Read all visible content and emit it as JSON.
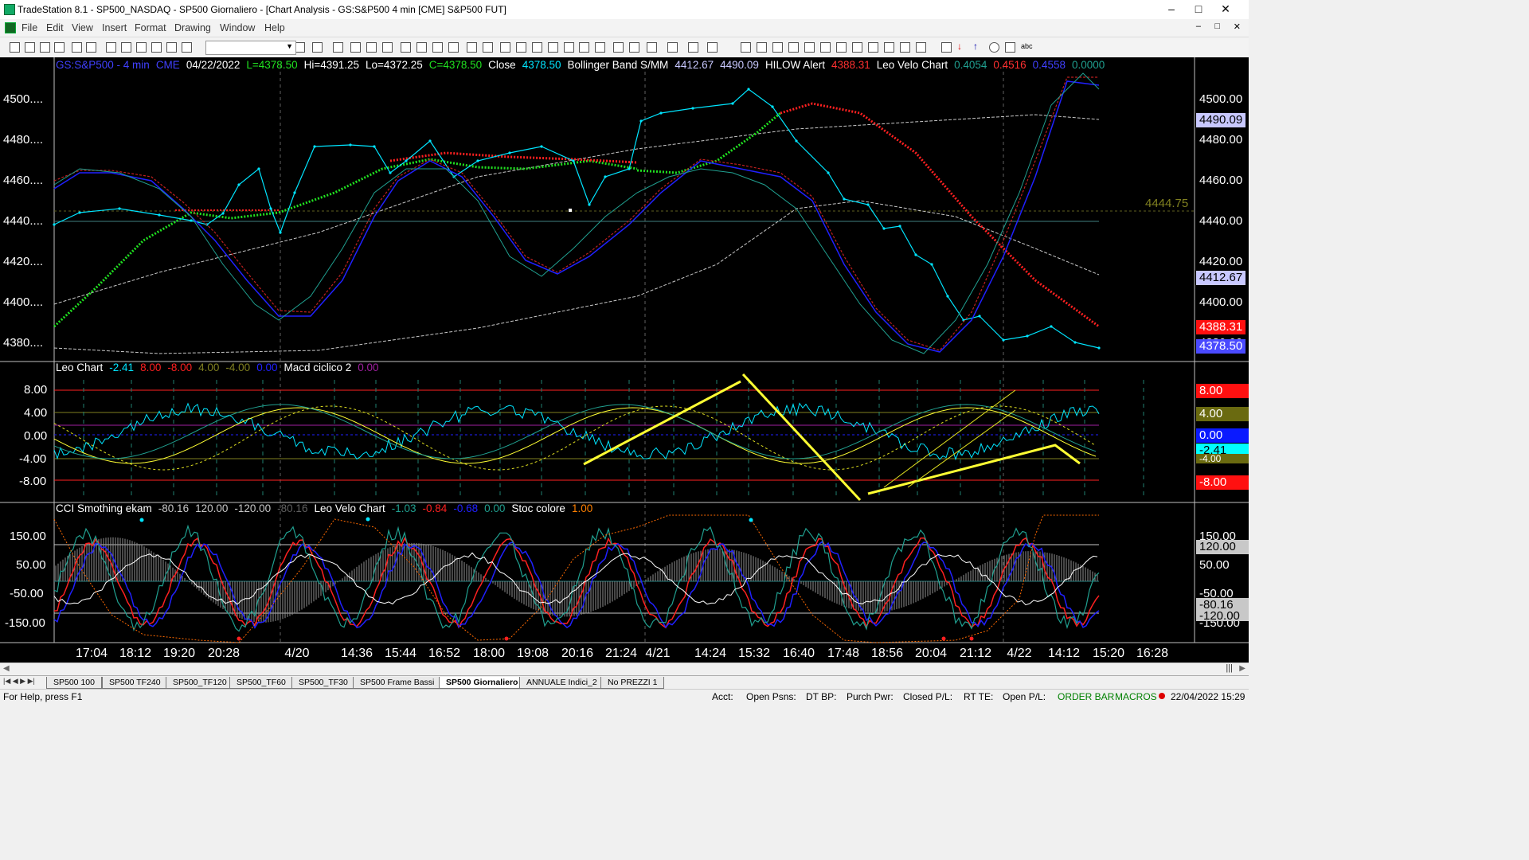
{
  "window": {
    "title": "TradeStation 8.1 - SP500_NASDAQ - SP500 Giornaliero - [Chart Analysis - GS:S&P500  4 min  [CME] S&P500 FUT]"
  },
  "menu": [
    "File",
    "Edit",
    "View",
    "Insert",
    "Format",
    "Drawing",
    "Window",
    "Help"
  ],
  "price_legend": {
    "symbol": "GS:S&P500 - 4 min",
    "exchange": "CME",
    "date": "04/22/2022",
    "low": "L=4378.50",
    "high": "Hi=4391.25",
    "lo": "Lo=4372.25",
    "close_field": "C=4378.50",
    "close_label": "Close",
    "close_value": "4378.50",
    "bb_label": "Bollinger Band S/MM",
    "bb_v1": "4412.67",
    "bb_v2": "4490.09",
    "hilow_label": "HILOW Alert",
    "hilow_v": "4388.31",
    "lvc_label": "Leo Velo Chart",
    "lvc_v1": "0.4054",
    "lvc_v2": "0.4516",
    "lvc_v3": "0.4558",
    "lvc_v4": "0.0000"
  },
  "price_axis": [
    "4500....",
    "4480....",
    "4460....",
    "4440....",
    "4420....",
    "4400....",
    "4380...."
  ],
  "price_tags": {
    "bb_upper": "4490.09",
    "bb_lower": "4412.67",
    "hilow": "4388.31",
    "last": "4378.50",
    "hline": "4444.75"
  },
  "right_axis": [
    "4500.00",
    "4480.00",
    "4460.00",
    "4440.00",
    "4420.00",
    "4400.00",
    "4380.00"
  ],
  "leo_legend": {
    "name": "Leo Chart",
    "v1": "-2.41",
    "v2": "8.00",
    "v3": "-8.00",
    "v4": "4.00",
    "v5": "-4.00",
    "v6": "0.00",
    "macd_label": "Macd ciclico 2",
    "macd_v": "0.00"
  },
  "leo_axis": [
    "8.00",
    "4.00",
    "0.00",
    "-4.00",
    "-8.00"
  ],
  "leo_tags": [
    "8.00",
    "4.00",
    "0.00",
    "-2.41",
    "-4.00",
    "-8.00"
  ],
  "cci_legend": {
    "name": "CCI Smothing ekam",
    "v1": "-80.16",
    "v2": "120.00",
    "v3": "-120.00",
    "v4": "-80.16",
    "lvc_label": "Leo Velo Chart",
    "lvc_v1": "-1.03",
    "lvc_v2": "-0.84",
    "lvc_v3": "-0.68",
    "lvc_v4": "0.00",
    "stoc_label": "Stoc colore",
    "stoc_v": "1.00"
  },
  "cci_axis": [
    "150.00",
    "50.00",
    "-50.00",
    "-150.00"
  ],
  "cci_right_axis": [
    "150.00",
    "50.00",
    "-50.00",
    "-150.00"
  ],
  "cci_tags": [
    "120.00",
    "-80.16",
    "-120.00"
  ],
  "time_axis": [
    "17:04",
    "18:12",
    "19:20",
    "20:28",
    "4/20",
    "14:36",
    "15:44",
    "16:52",
    "18:00",
    "19:08",
    "20:16",
    "21:24",
    "4/21",
    "14:24",
    "15:32",
    "16:40",
    "17:48",
    "18:56",
    "20:04",
    "21:12",
    "4/22",
    "14:12",
    "15:20",
    "16:28"
  ],
  "tabs": [
    "SP500 100",
    "SP500 TF240",
    "SP500_TF120",
    "SP500_TF60",
    "SP500_TF30",
    "SP500 Frame Bassi",
    "SP500 Giornaliero",
    "ANNUALE Indici_2",
    "No PREZZI 1"
  ],
  "active_tab": "SP500 Giornaliero",
  "status": {
    "help": "For Help, press F1",
    "acct": "Acct:",
    "open_psns": "Open Psns:",
    "dt_bp": "DT BP:",
    "purch": "Purch Pwr:",
    "closed_pl": "Closed P/L:",
    "rt_te": "RT TE:",
    "open_pl": "Open P/L:",
    "order_bar": "ORDER BAR",
    "macros": "MACROS",
    "datetime": "22/04/2022 15:29"
  },
  "colors": {
    "up": "#00e5ff",
    "hilow": "#ff2020",
    "green": "#20e020",
    "bb": "#c8c8c8",
    "yellow": "#ffff33"
  }
}
